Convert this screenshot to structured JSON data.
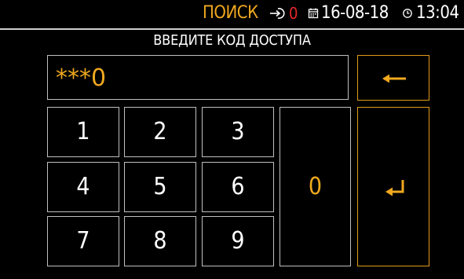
{
  "status": {
    "mode": "ПОИСК",
    "signal_icon": "signal-input-icon",
    "count": "0",
    "count_color": "#e82828",
    "calendar_icon": "calendar-icon",
    "date": "16-08-18",
    "clock_icon": "clock-icon",
    "time": "13:04"
  },
  "title": "ВВЕДИТЕ КОД ДОСТУПА",
  "code": "***0",
  "keypad": {
    "keys": [
      "1",
      "2",
      "3",
      "4",
      "5",
      "6",
      "7",
      "8",
      "9",
      "0"
    ],
    "backspace_icon": "backspace-arrow-icon",
    "enter_icon": "enter-return-icon"
  },
  "colors": {
    "accent": "#f0a81e",
    "text": "#ffffff",
    "border": "#bfbfbf",
    "background": "#000000"
  }
}
